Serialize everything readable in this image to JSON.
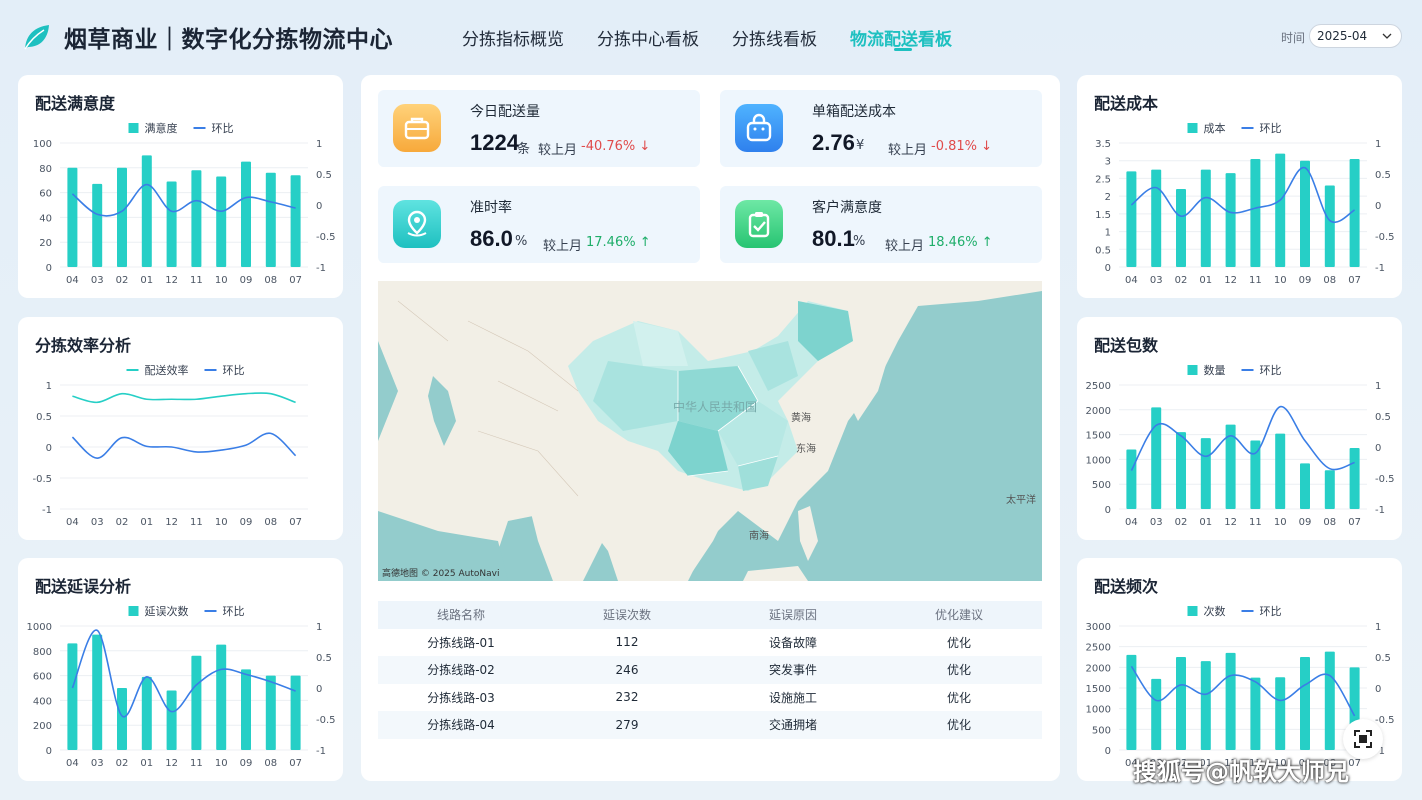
{
  "header": {
    "title": "烟草商业｜数字化分拣物流中心",
    "nav": [
      "分拣指标概览",
      "分拣中心看板",
      "分拣线看板",
      "物流配送看板"
    ],
    "active_nav": 3,
    "time_label": "时间",
    "time_value": "2025-04"
  },
  "colors": {
    "bar": "#26cfc6",
    "line": "#3a7ee6",
    "accent": "#1ec0c0",
    "down": "#e04b4b",
    "up": "#1fae6a"
  },
  "kpis": [
    {
      "label": "今日配送量",
      "value": "1224",
      "unit": "条",
      "compare": "较上月",
      "pct": "-40.76%",
      "trend": "down",
      "icon": "briefcase-icon"
    },
    {
      "label": "单箱配送成本",
      "value": "2.76",
      "unit": "¥",
      "compare": "较上月",
      "pct": "-0.81%",
      "trend": "down",
      "icon": "shopping-bag-icon"
    },
    {
      "label": "准时率",
      "value": "86.0",
      "unit": "%",
      "compare": "较上月",
      "pct": "17.46%",
      "trend": "up",
      "icon": "location-pin-icon"
    },
    {
      "label": "客户满意度",
      "value": "80.1",
      "unit": "%",
      "compare": "较上月",
      "pct": "18.46%",
      "trend": "up",
      "icon": "clipboard-check-icon"
    }
  ],
  "map": {
    "labels": {
      "country": "中华人民共和国",
      "yellow_sea": "黄海",
      "east_sea": "东海",
      "south_sea": "南海",
      "pacific": "太平洋"
    },
    "attribution": "高德地图 © 2025 AutoNavi"
  },
  "table": {
    "headers": [
      "线路名称",
      "延误次数",
      "延误原因",
      "优化建议"
    ],
    "rows": [
      [
        "分拣线路-01",
        "112",
        "设备故障",
        "优化"
      ],
      [
        "分拣线路-02",
        "246",
        "突发事件",
        "优化"
      ],
      [
        "分拣线路-03",
        "232",
        "设施施工",
        "优化"
      ],
      [
        "分拣线路-04",
        "279",
        "交通拥堵",
        "优化"
      ]
    ]
  },
  "chart_data": [
    {
      "id": "satisfaction",
      "type": "bar",
      "title": "配送满意度",
      "categories": [
        "04",
        "03",
        "02",
        "01",
        "12",
        "11",
        "10",
        "09",
        "08",
        "07"
      ],
      "series": [
        {
          "name": "满意度",
          "type": "bar",
          "values": [
            80,
            67,
            80,
            90,
            69,
            78,
            73,
            85,
            76,
            74
          ]
        },
        {
          "name": "环比",
          "type": "line",
          "axis": "right",
          "values": [
            0.18,
            -0.15,
            -0.1,
            0.33,
            -0.1,
            0.07,
            -0.1,
            0.12,
            0.05,
            -0.05
          ]
        }
      ],
      "ylim": [
        0,
        100
      ],
      "yticks": [
        0,
        20,
        40,
        60,
        80,
        100
      ],
      "y2lim": [
        -1,
        1
      ],
      "y2ticks": [
        "1",
        "0.5",
        "0",
        "-0.5",
        "-1"
      ]
    },
    {
      "id": "efficiency",
      "type": "line",
      "title": "分拣效率分析",
      "categories": [
        "04",
        "03",
        "02",
        "01",
        "12",
        "11",
        "10",
        "09",
        "08",
        "07"
      ],
      "series": [
        {
          "name": "配送效率",
          "type": "line",
          "color": "#26cfc6",
          "values": [
            0.82,
            0.72,
            0.86,
            0.77,
            0.77,
            0.77,
            0.82,
            0.86,
            0.86,
            0.72
          ]
        },
        {
          "name": "环比",
          "type": "line",
          "values": [
            0.16,
            -0.18,
            0.15,
            0.01,
            0.0,
            -0.08,
            -0.05,
            0.03,
            0.22,
            -0.14
          ]
        }
      ],
      "ylim": [
        -1,
        1
      ],
      "yticks": [
        "1",
        "0.5",
        "0",
        "-0.5",
        "-1"
      ]
    },
    {
      "id": "delay",
      "type": "bar",
      "title": "配送延误分析",
      "categories": [
        "04",
        "03",
        "02",
        "01",
        "12",
        "11",
        "10",
        "09",
        "08",
        "07"
      ],
      "series": [
        {
          "name": "延误次数",
          "type": "bar",
          "values": [
            860,
            930,
            500,
            590,
            480,
            760,
            850,
            650,
            600,
            600
          ]
        },
        {
          "name": "环比",
          "type": "line",
          "axis": "right",
          "values": [
            0.0,
            0.93,
            -0.45,
            0.18,
            -0.38,
            0.05,
            0.3,
            0.22,
            0.1,
            -0.05
          ]
        }
      ],
      "ylim": [
        0,
        1000
      ],
      "yticks": [
        0,
        200,
        400,
        600,
        800,
        1000
      ],
      "y2lim": [
        -1,
        1
      ],
      "y2ticks": [
        "1",
        "0.5",
        "0",
        "-0.5",
        "-1"
      ]
    },
    {
      "id": "cost",
      "type": "bar",
      "title": "配送成本",
      "categories": [
        "04",
        "03",
        "02",
        "01",
        "12",
        "11",
        "10",
        "09",
        "08",
        "07"
      ],
      "series": [
        {
          "name": "成本",
          "type": "bar",
          "values": [
            2.7,
            2.75,
            2.2,
            2.75,
            2.65,
            3.05,
            3.2,
            3.0,
            2.3,
            3.05
          ]
        },
        {
          "name": "环比",
          "type": "line",
          "axis": "right",
          "values": [
            0.0,
            0.28,
            -0.18,
            0.12,
            -0.12,
            -0.05,
            0.08,
            0.6,
            -0.25,
            -0.08
          ]
        }
      ],
      "ylim": [
        0,
        3.5
      ],
      "yticks": [
        "0",
        "0.5",
        "1",
        "1.5",
        "2",
        "2.5",
        "3",
        "3.5"
      ],
      "y2lim": [
        -1,
        1
      ],
      "y2ticks": [
        "1",
        "0.5",
        "0",
        "-0.5",
        "-1"
      ]
    },
    {
      "id": "packages",
      "type": "bar",
      "title": "配送包数",
      "categories": [
        "04",
        "03",
        "02",
        "01",
        "12",
        "11",
        "10",
        "09",
        "08",
        "07"
      ],
      "series": [
        {
          "name": "数量",
          "type": "bar",
          "values": [
            1200,
            2050,
            1550,
            1430,
            1700,
            1380,
            1520,
            920,
            780,
            1230
          ]
        },
        {
          "name": "环比",
          "type": "line",
          "axis": "right",
          "values": [
            -0.38,
            0.35,
            0.18,
            -0.15,
            0.18,
            -0.1,
            0.65,
            0.1,
            -0.35,
            -0.25
          ]
        }
      ],
      "ylim": [
        0,
        2500
      ],
      "yticks": [
        0,
        500,
        1000,
        1500,
        2000,
        2500
      ],
      "y2lim": [
        -1,
        1
      ],
      "y2ticks": [
        "1",
        "0.5",
        "0",
        "-0.5",
        "-1"
      ]
    },
    {
      "id": "frequency",
      "type": "bar",
      "title": "配送频次",
      "categories": [
        "04",
        "03",
        "02",
        "01",
        "12",
        "11",
        "10",
        "09",
        "08",
        "07"
      ],
      "series": [
        {
          "name": "次数",
          "type": "bar",
          "values": [
            2300,
            1720,
            2250,
            2150,
            2350,
            1750,
            1760,
            2250,
            2380,
            2000
          ]
        },
        {
          "name": "环比",
          "type": "line",
          "axis": "right",
          "values": [
            0.35,
            -0.2,
            0.05,
            -0.1,
            0.2,
            0.1,
            -0.2,
            0.05,
            0.2,
            -0.45
          ]
        }
      ],
      "ylim": [
        0,
        3000
      ],
      "yticks": [
        0,
        500,
        1000,
        1500,
        2000,
        2500,
        3000
      ],
      "y2lim": [
        -1,
        1
      ],
      "y2ticks": [
        "1",
        "0.5",
        "0",
        "-0.5",
        "-1"
      ]
    }
  ],
  "watermark": "搜狐号@帆软大师兄"
}
